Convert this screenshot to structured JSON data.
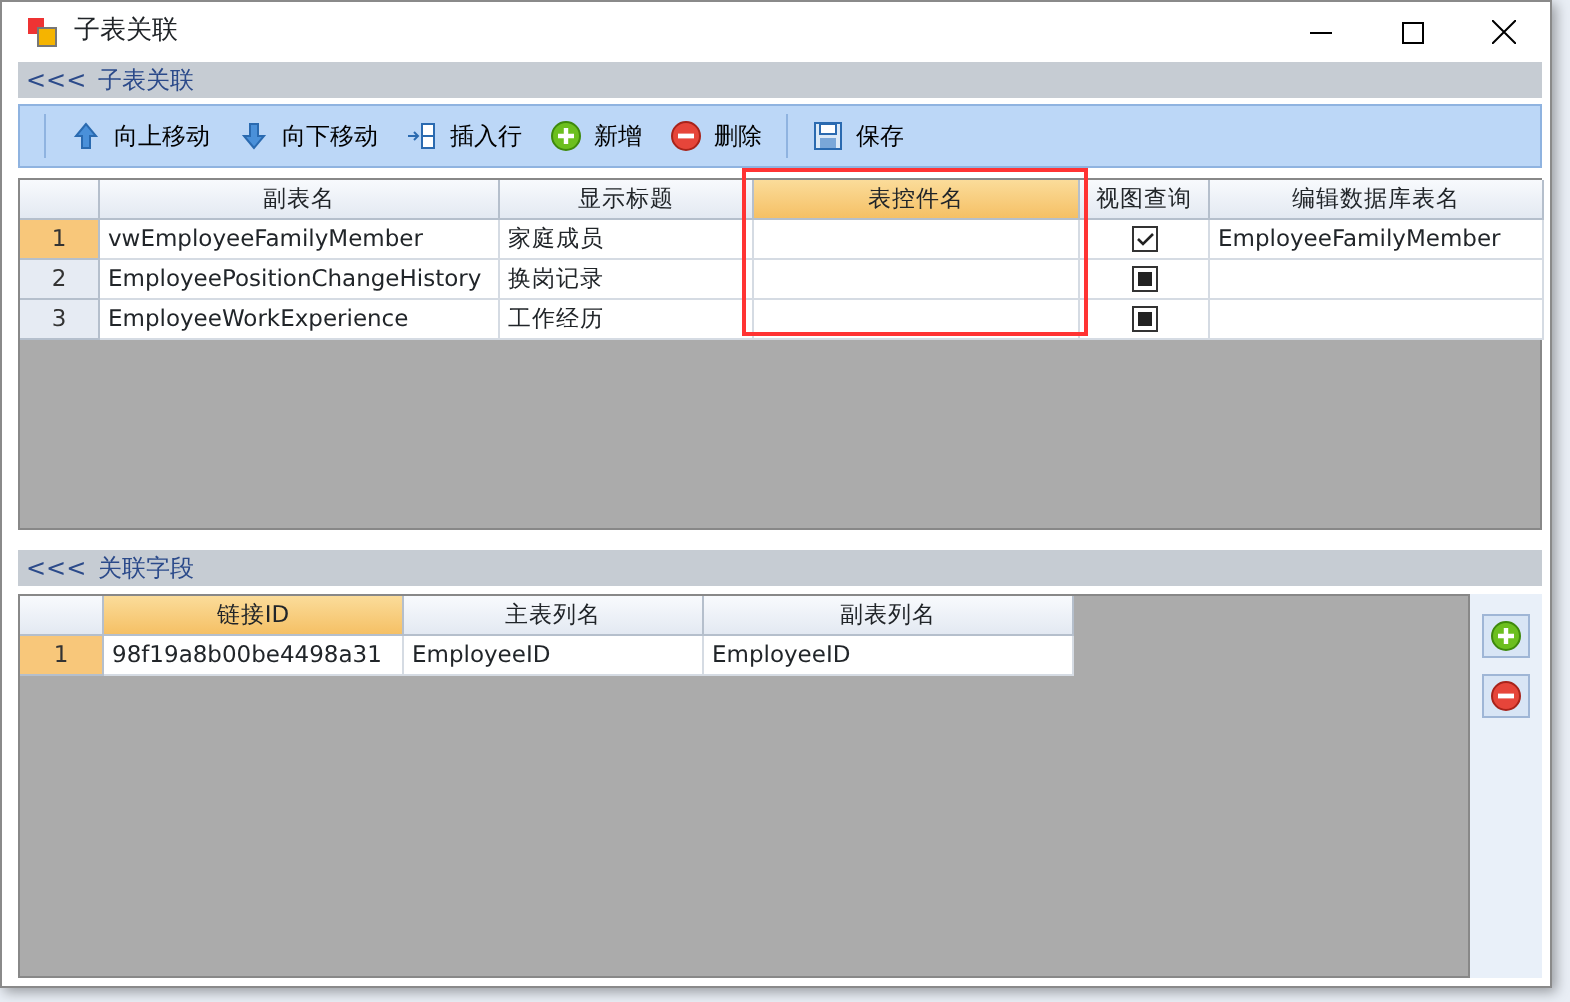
{
  "window": {
    "title": "子表关联"
  },
  "sections": [
    {
      "arrows": "<<<",
      "title": "子表关联"
    },
    {
      "arrows": "<<<",
      "title": "关联字段"
    }
  ],
  "toolbar": [
    {
      "kind": "up",
      "label": "向上移动"
    },
    {
      "kind": "down",
      "label": "向下移动"
    },
    {
      "kind": "insert",
      "label": "插入行"
    },
    {
      "kind": "add",
      "label": "新增"
    },
    {
      "kind": "delete",
      "label": "删除"
    },
    {
      "kind": "separator"
    },
    {
      "kind": "save",
      "label": "保存"
    }
  ],
  "child_grid": {
    "columns": [
      {
        "label": "副表名",
        "selected": false,
        "highlighted": false
      },
      {
        "label": "显示标题",
        "selected": false,
        "highlighted": false
      },
      {
        "label": "表控件名",
        "selected": true,
        "highlighted": true
      },
      {
        "label": "视图查询",
        "selected": false,
        "highlighted": false
      },
      {
        "label": "编辑数据库表名",
        "selected": false,
        "highlighted": false
      }
    ],
    "rows": [
      {
        "number": "1",
        "selected": true,
        "table": "vwEmployeeFamilyMember",
        "caption": "家庭成员",
        "control": "",
        "view_query": {
          "checked": true
        },
        "edit_table": "EmployeeFamilyMember"
      },
      {
        "number": "2",
        "selected": false,
        "table": "EmployeePositionChangeHistory",
        "caption": "换岗记录",
        "control": "",
        "view_query": {
          "checked": false
        },
        "edit_table": ""
      },
      {
        "number": "3",
        "selected": false,
        "table": "EmployeeWorkExperience",
        "caption": "工作经历",
        "control": "",
        "view_query": {
          "checked": false
        },
        "edit_table": ""
      }
    ]
  },
  "link_grid": {
    "columns": [
      {
        "label": "链接ID",
        "selected": true
      },
      {
        "label": "主表列名",
        "selected": false
      },
      {
        "label": "副表列名",
        "selected": false
      }
    ],
    "rows": [
      {
        "number": "1",
        "selected": true,
        "cells": [
          "98f19a8b00be4498a31",
          "EmployeeID",
          "EmployeeID"
        ]
      }
    ]
  },
  "side_buttons": [
    {
      "kind": "add"
    },
    {
      "kind": "delete"
    }
  ]
}
